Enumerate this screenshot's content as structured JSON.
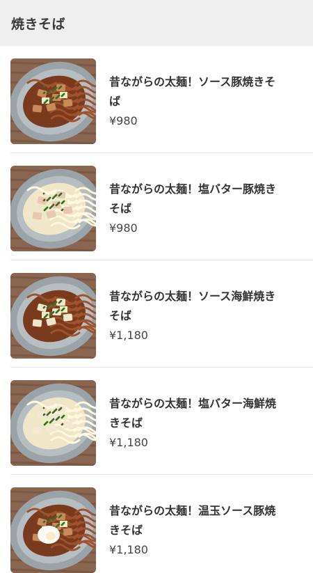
{
  "header": {
    "title": "焼きそば"
  },
  "items": [
    {
      "name": "昔ながらの太麺！ソース豚焼きそば",
      "price": "¥980",
      "noodle": "#7a3a1e",
      "accent": "#c98a5a",
      "egg": false
    },
    {
      "name": "昔ながらの太麺！塩バター豚焼きそば",
      "price": "¥980",
      "noodle": "#efe7c8",
      "accent": "#e8c8b0",
      "egg": false
    },
    {
      "name": "昔ながらの太麺！ソース海鮮焼きそば",
      "price": "¥1,180",
      "noodle": "#7a3a1e",
      "accent": "#f0e6c8",
      "egg": false
    },
    {
      "name": "昔ながらの太麺！塩バター海鮮焼きそば",
      "price": "¥1,180",
      "noodle": "#efe7c8",
      "accent": "#f3e9d2",
      "egg": false
    },
    {
      "name": "昔ながらの太麺！温玉ソース豚焼きそば",
      "price": "¥1,180",
      "noodle": "#7a3a1e",
      "accent": "#c98a5a",
      "egg": true
    }
  ]
}
